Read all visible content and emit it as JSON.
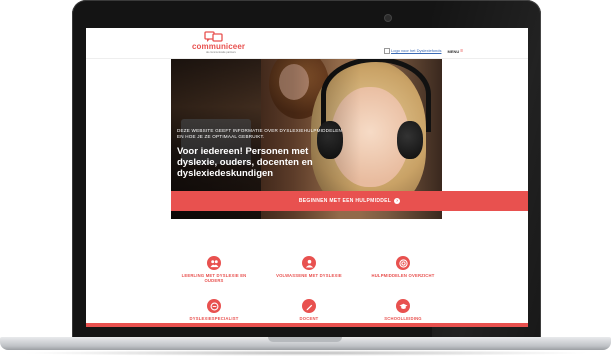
{
  "header": {
    "logo_text": "communiceer",
    "logo_subtext": "de communicatie partners",
    "broken_image_alt": "Logo voor het Dyslexiefonds",
    "menu_label": "MENU"
  },
  "hero": {
    "intro": "DEZE WEBSITE GEEFT INFORMATIE OVER DYSLEXIEHULPMIDDELEN EN HOE JE ZE OPTIMAAL GEBRUIKT.",
    "title": "Voor iedereen! Personen met dyslexie, ouders, docenten en dyslexiedeskundigen",
    "slides": 4,
    "active_slide": 2
  },
  "cta": {
    "label": "BEGINNEN MET EEN HULPMIDDEL",
    "icon": "arrow-right-circle-icon"
  },
  "tiles": [
    {
      "label": "LEERLING MET DYSLEXIE EN OUDERS",
      "icon": "students-icon"
    },
    {
      "label": "VOLWASSENE MET DYSLEXIE",
      "icon": "person-icon"
    },
    {
      "label": "HULPMIDDELEN OVERZICHT",
      "icon": "lifebuoy-icon"
    },
    {
      "label": "DYSLEXIESPECIALIST",
      "icon": "chat-icon"
    },
    {
      "label": "DOCENT",
      "icon": "pen-icon"
    },
    {
      "label": "SCHOOLLEIDING",
      "icon": "graduation-cap-icon"
    }
  ],
  "colors": {
    "brand": "#e8514f",
    "text": "#ffffff"
  }
}
